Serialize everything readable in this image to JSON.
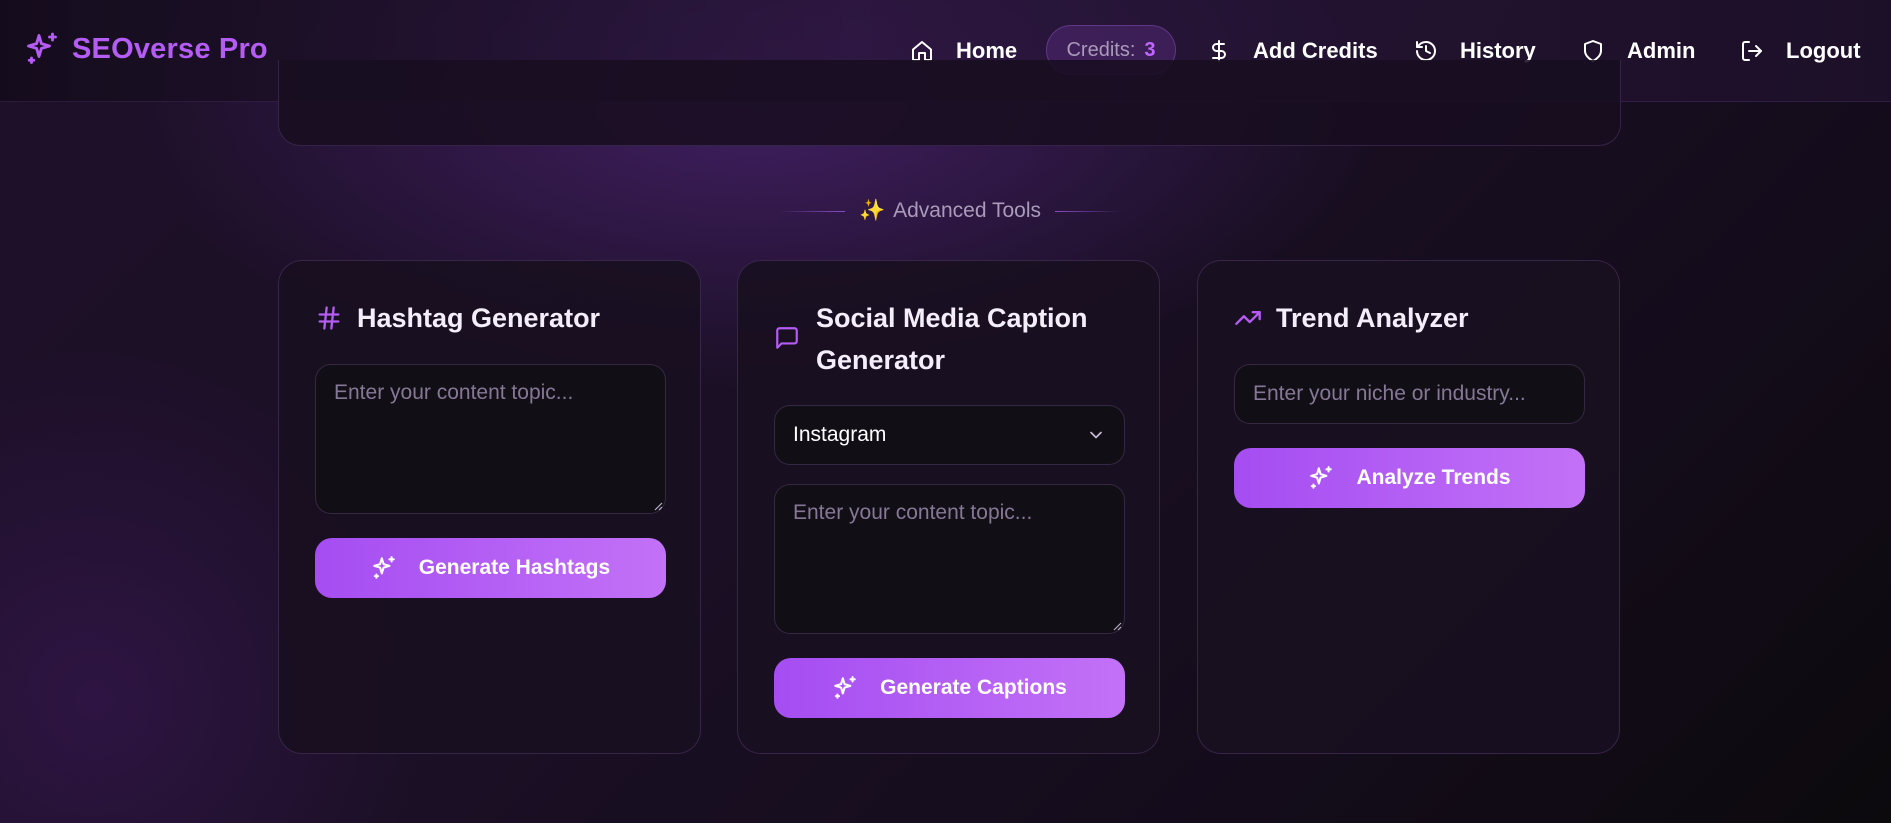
{
  "navbar": {
    "brand": {
      "name": "SEOverse Pro",
      "icon": "sparkles-icon"
    },
    "items": [
      {
        "label": "Home",
        "icon": "home-icon"
      },
      {
        "label": "Add Credits",
        "icon": "dollar-icon"
      },
      {
        "label": "History",
        "icon": "history-icon"
      },
      {
        "label": "Admin",
        "icon": "shield-icon"
      },
      {
        "label": "Logout",
        "icon": "logout-icon"
      }
    ],
    "credits": {
      "label": "Credits:",
      "value": "3"
    }
  },
  "section": {
    "emoji": "✨",
    "title": "Advanced Tools"
  },
  "cards": [
    {
      "title": "Hashtag Generator",
      "icon": "hash-icon",
      "textarea_placeholder": "Enter your content topic...",
      "button_label": "Generate Hashtags",
      "button_icon": "sparkles-icon"
    },
    {
      "title": "Social Media Caption Generator",
      "icon": "message-square-icon",
      "select_value": "Instagram",
      "textarea_placeholder": "Enter your content topic...",
      "button_label": "Generate Captions",
      "button_icon": "sparkles-icon"
    },
    {
      "title": "Trend Analyzer",
      "icon": "trending-up-icon",
      "input_placeholder": "Enter your niche or industry...",
      "button_label": "Analyze Trends",
      "button_icon": "sparkles-icon"
    }
  ],
  "colors": {
    "accent": "#b45cf3",
    "button_gradient_start": "#a54df2",
    "button_gradient_end": "#c371f7",
    "credits_value": "#c066ff"
  }
}
